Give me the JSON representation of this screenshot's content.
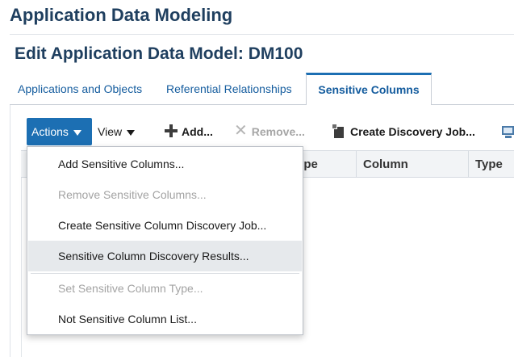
{
  "header": {
    "app_title": "Application Data Modeling",
    "page_title": "Edit Application Data Model: DM100"
  },
  "tabs": [
    {
      "label": "Applications and Objects",
      "active": false
    },
    {
      "label": "Referential Relationships",
      "active": false
    },
    {
      "label": "Sensitive Columns",
      "active": true
    }
  ],
  "toolbar": {
    "actions_label": "Actions",
    "view_label": "View",
    "add_label": "Add...",
    "remove_label": "Remove...",
    "create_job_label": "Create Discovery Job...",
    "icons": [
      "plus-icon",
      "x-icon",
      "job-icon",
      "monitor-icon"
    ]
  },
  "table": {
    "columns": [
      "ype",
      "Column",
      "Type"
    ]
  },
  "actions_menu": {
    "items": [
      {
        "label": "Add Sensitive Columns...",
        "enabled": true
      },
      {
        "label": "Remove Sensitive Columns...",
        "enabled": false
      },
      {
        "label": "Create Sensitive Column Discovery Job...",
        "enabled": true
      },
      {
        "label": "Sensitive Column Discovery Results...",
        "enabled": true,
        "highlighted": true
      },
      {
        "label": "Set Sensitive Column Type...",
        "enabled": false
      },
      {
        "label": "Not Sensitive Column List...",
        "enabled": true
      }
    ]
  },
  "colors": {
    "accent": "#1c6fb3",
    "title": "#1f3f5f",
    "link": "#145c9e",
    "disabled": "#a3a3a3",
    "menu_highlight": "#e6e9ec"
  }
}
